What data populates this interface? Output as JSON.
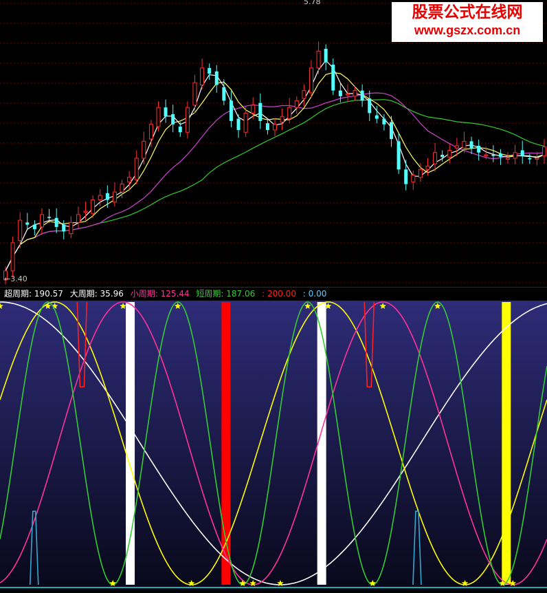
{
  "watermark": {
    "cn": "股票公式在线网",
    "url": "www.gszx.com.cn"
  },
  "price_panel": {
    "high_label": "5.78",
    "low_label": "←3.40"
  },
  "indicator_bar": {
    "items": [
      {
        "label": "超周期: 190.57",
        "color": "#ffffff"
      },
      {
        "label": "大周期: 35.96",
        "color": "#ffffff"
      },
      {
        "label": "小周期: 125.44",
        "color": "#ff3399"
      },
      {
        "label": "短周期: 187.06",
        "color": "#33cc33"
      },
      {
        "label": ": 200.00",
        "color": "#ff2020"
      },
      {
        "label": ": 0.00",
        "color": "#66ccff"
      }
    ]
  },
  "chart_data": [
    {
      "type": "candlestick",
      "title": "",
      "ylim": [
        3.4,
        5.78
      ],
      "candles_close": [
        3.45,
        3.7,
        3.9,
        3.86,
        3.82,
        3.95,
        3.92,
        3.84,
        3.8,
        3.88,
        3.95,
        3.98,
        4.08,
        4.12,
        4.08,
        4.15,
        4.22,
        4.28,
        4.45,
        4.6,
        4.75,
        4.9,
        4.82,
        4.75,
        4.68,
        4.9,
        5.12,
        5.25,
        5.2,
        5.1,
        4.96,
        4.78,
        4.7,
        4.85,
        4.92,
        4.78,
        4.7,
        4.75,
        4.82,
        4.9,
        4.96,
        5.05,
        5.25,
        5.4,
        5.3,
        5.05,
        5.0,
        5.02,
        5.05,
        4.96,
        4.85,
        4.8,
        4.75,
        4.62,
        4.35,
        4.22,
        4.3,
        4.35,
        4.38,
        4.5,
        4.46,
        4.52,
        4.56,
        4.6,
        4.54,
        4.5,
        4.48,
        4.47,
        4.46,
        4.45,
        4.5,
        4.47,
        4.44,
        4.45,
        4.55
      ],
      "ma_colors": {
        "ma5": "#ffffff",
        "ma10": "#ffff66",
        "ma30": "#cc44cc",
        "ma60": "#33cc33"
      },
      "up_color": "#ff3030",
      "down_color": "#54ffff",
      "grid": "dotted-red-horizontal"
    },
    {
      "type": "line",
      "title": "",
      "ylim": [
        0,
        200
      ],
      "series": [
        {
          "name": "超周期",
          "color": "#ffffff",
          "period_bars": 82,
          "phase_bars": 0
        },
        {
          "name": "大周期",
          "color": "#ffff00",
          "period_bars": 40,
          "phase_bars": 8
        },
        {
          "name": "小周期",
          "color": "#ff3399",
          "period_bars": 38,
          "phase_bars": 18
        },
        {
          "name": "短周期",
          "color": "#33cc33",
          "period_bars": 19,
          "phase_bars": 7
        }
      ],
      "vertical_bars": [
        {
          "bar": 19,
          "color": "#ffffff"
        },
        {
          "bar": 33,
          "color": "#ff0000"
        },
        {
          "bar": 47,
          "color": "#ffffff"
        },
        {
          "bar": 74,
          "color": "#ffff00"
        }
      ],
      "red_spikes_bars": [
        12,
        54
      ],
      "blue_spikes_bars": [
        5,
        61
      ],
      "star_color": "#ffff00",
      "background": "navy-gradient"
    }
  ]
}
